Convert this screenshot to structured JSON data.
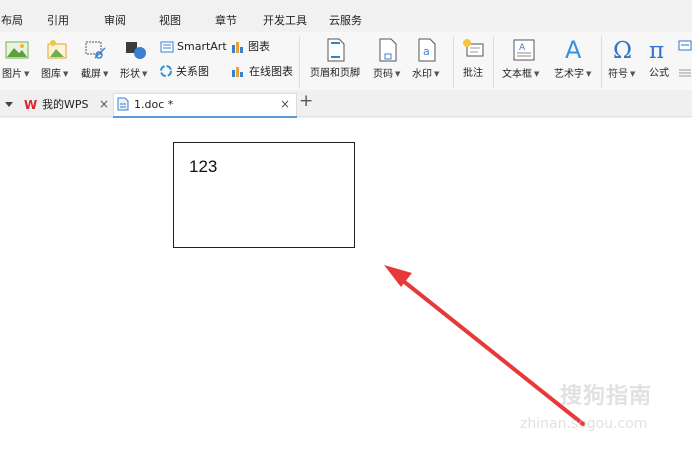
{
  "menu": {
    "items": [
      "布局",
      "引用",
      "审阅",
      "视图",
      "章节",
      "开发工具",
      "云服务"
    ]
  },
  "ribbon": {
    "picture": "图片",
    "gallery": "图库",
    "screenshot": "截屏",
    "shapes": "形状",
    "smartart": "SmartArt",
    "chart": "图表",
    "relation": "关系图",
    "online_chart": "在线图表",
    "header_footer": "页眉和页脚",
    "page_number": "页码",
    "watermark": "水印",
    "comment": "批注",
    "textbox": "文本框",
    "wordart": "艺术字",
    "symbol": "符号",
    "formula": "公式"
  },
  "tabs": {
    "home_label": "我的WPS",
    "doc_label": "1.doc *",
    "close_symbol": "×",
    "add_symbol": "+"
  },
  "document": {
    "textbox_text": "123"
  },
  "watermark": {
    "brand": "搜狗指南",
    "url": "zhinan.sogou.com"
  },
  "colors": {
    "accent": "#5b9bd5",
    "arrow": "#e8393a",
    "wps_red": "#d9272e"
  }
}
